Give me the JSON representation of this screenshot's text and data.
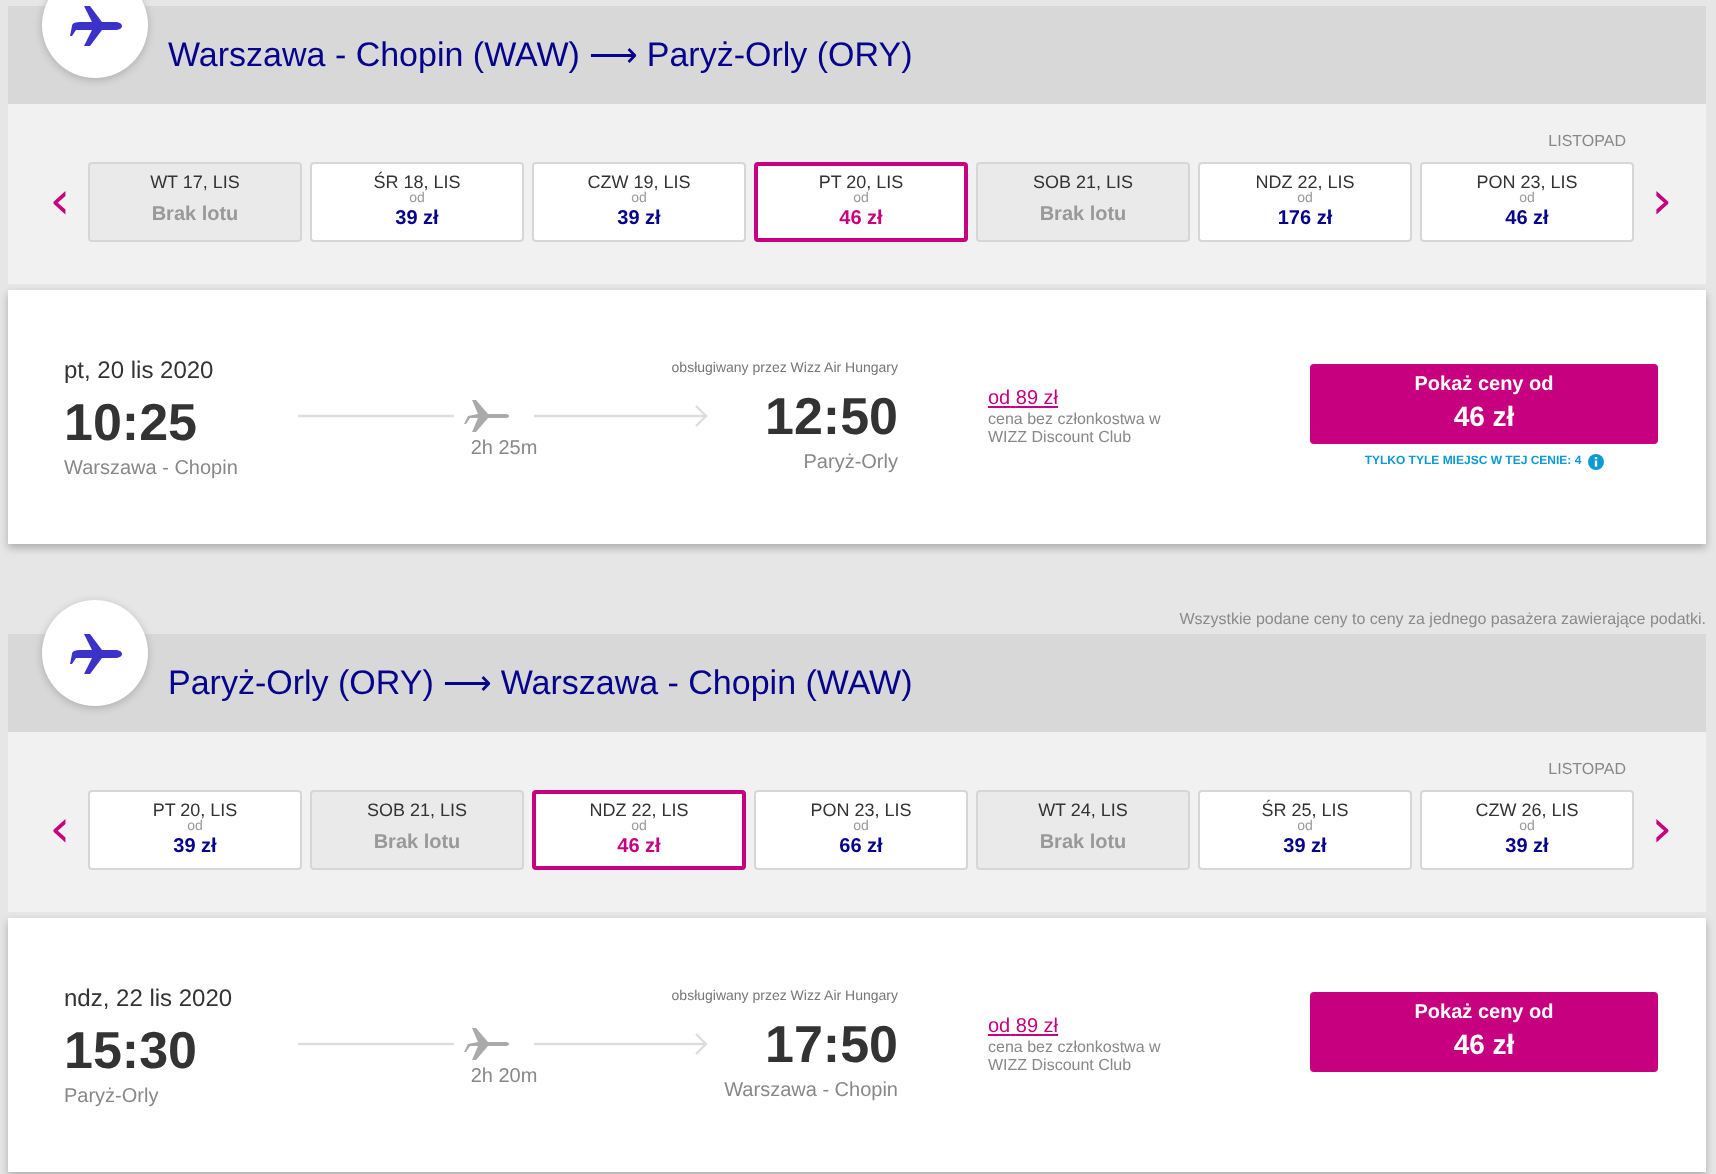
{
  "legs": [
    {
      "from": "Warszawa - Chopin (WAW)",
      "arrow": "⟶",
      "to": "Paryż-Orly (ORY)",
      "month": "LISTOPAD",
      "prev": "‹",
      "next": "›",
      "dates": [
        {
          "kind": "none",
          "day": "WT 17, LIS",
          "text": "Brak lotu",
          "selected": false
        },
        {
          "kind": "fare",
          "day": "ŚR 18, LIS",
          "od": "od",
          "price": "39 zł",
          "selected": false
        },
        {
          "kind": "fare",
          "day": "CZW 19, LIS",
          "od": "od",
          "price": "39 zł",
          "selected": false
        },
        {
          "kind": "fare",
          "day": "PT 20, LIS",
          "od": "od",
          "price": "46 zł",
          "selected": true
        },
        {
          "kind": "none",
          "day": "SOB 21, LIS",
          "text": "Brak lotu",
          "selected": false
        },
        {
          "kind": "fare",
          "day": "NDZ 22, LIS",
          "od": "od",
          "price": "176 zł",
          "selected": false
        },
        {
          "kind": "fare",
          "day": "PON 23, LIS",
          "od": "od",
          "price": "46 zł",
          "selected": false
        }
      ],
      "flight": {
        "date": "pt, 20 lis 2020",
        "dep_time": "10:25",
        "dep_airport": "Warszawa - Chopin",
        "duration": "2h 25m",
        "operator": "obsługiwany przez Wizz Air Hungary",
        "arr_time": "12:50",
        "arr_airport": "Paryż-Orly",
        "club_od": "od",
        "club_price": "89 zł",
        "club_note": "cena bez członkostwa w WIZZ Discount Club",
        "button_label": "Pokaż ceny od",
        "button_price": "46 zł",
        "seats_note": "TYLKO TYLE MIEJSC W TEJ CENIE: 4"
      }
    },
    {
      "note": "Wszystkie podane ceny to ceny za jednego pasażera zawierające podatki.",
      "from": "Paryż-Orly (ORY)",
      "arrow": "⟶",
      "to": "Warszawa - Chopin (WAW)",
      "month": "LISTOPAD",
      "prev": "‹",
      "next": "›",
      "dates": [
        {
          "kind": "fare",
          "day": "PT 20, LIS",
          "od": "od",
          "price": "39 zł",
          "selected": false
        },
        {
          "kind": "none",
          "day": "SOB 21, LIS",
          "text": "Brak lotu",
          "selected": false
        },
        {
          "kind": "fare",
          "day": "NDZ 22, LIS",
          "od": "od",
          "price": "46 zł",
          "selected": true
        },
        {
          "kind": "fare",
          "day": "PON 23, LIS",
          "od": "od",
          "price": "66 zł",
          "selected": false
        },
        {
          "kind": "none",
          "day": "WT 24, LIS",
          "text": "Brak lotu",
          "selected": false
        },
        {
          "kind": "fare",
          "day": "ŚR 25, LIS",
          "od": "od",
          "price": "39 zł",
          "selected": false
        },
        {
          "kind": "fare",
          "day": "CZW 26, LIS",
          "od": "od",
          "price": "39 zł",
          "selected": false
        }
      ],
      "flight": {
        "date": "ndz, 22 lis 2020",
        "dep_time": "15:30",
        "dep_airport": "Paryż-Orly",
        "duration": "2h 20m",
        "operator": "obsługiwany przez Wizz Air Hungary",
        "arr_time": "17:50",
        "arr_airport": "Warszawa - Chopin",
        "club_od": "od",
        "club_price": "89 zł",
        "club_note": "cena bez członkostwa w WIZZ Discount Club",
        "button_label": "Pokaż ceny od",
        "button_price": "46 zł"
      }
    }
  ]
}
